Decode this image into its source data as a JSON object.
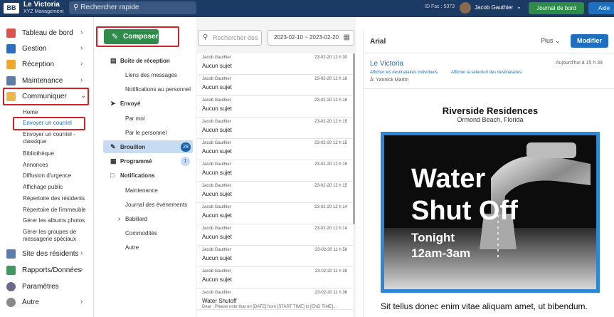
{
  "topbar": {
    "org_name": "Le Victoria",
    "org_sub": "XYZ Management",
    "search_label": "Rechercher rapide",
    "id_fac": "ID Fac : 5373",
    "user_name": "Jacob Gauthier",
    "dashboard_btn": "Journal de bord",
    "help_btn": "Aide",
    "colors": {
      "bar": "#1b3a64",
      "green": "#2e8b4a",
      "blue": "#1f6fc0"
    }
  },
  "sidebar": {
    "nav": [
      {
        "label": "Tableau de bord",
        "icon": "dashboard-icon"
      },
      {
        "label": "Gestion",
        "icon": "building-icon"
      },
      {
        "label": "Réception",
        "icon": "bell-icon"
      },
      {
        "label": "Maintenance",
        "icon": "wrench-icon"
      },
      {
        "label": "Communiquer",
        "icon": "envelope-icon"
      },
      {
        "label": "Site des résidents",
        "icon": "monitor-icon"
      },
      {
        "label": "Rapports/Données",
        "icon": "chart-icon"
      },
      {
        "label": "Paramètres",
        "icon": "gear-icon"
      },
      {
        "label": "Autre",
        "icon": "more-icon"
      }
    ],
    "sub": [
      "Home",
      "Envoyer un courriel",
      "Envoyer un courriel - classique",
      "Bibliothèque",
      "Annonces",
      "Diffusion d'urgence",
      "Affichage public",
      "Répertoire des résidents",
      "Répertoire de l'immeuble",
      "Gérer les albums photos",
      "Gérer les groupes de messagerie spéciaux"
    ]
  },
  "folders": {
    "compose": "Composer",
    "items": [
      {
        "label": "Boîte de réception"
      },
      {
        "label": "Liens des messages"
      },
      {
        "label": "Notifications au personnel"
      },
      {
        "label": "Envoyé"
      },
      {
        "label": "Par moi"
      },
      {
        "label": "Par le personnel"
      },
      {
        "label": "Brouillon",
        "badge": "28"
      },
      {
        "label": "Programmé",
        "badge": "1"
      },
      {
        "label": "Notifications"
      },
      {
        "label": "Maintenance"
      },
      {
        "label": "Journal des événements"
      },
      {
        "label": "Babillard"
      },
      {
        "label": "Commodités"
      },
      {
        "label": "Autre"
      }
    ]
  },
  "messages": {
    "search_placeholder": "Rechercher des",
    "date_range": "2023-02-10 ~ 2023-02-20",
    "list": [
      {
        "from": "Jacob Gauthier",
        "date": "23-02-20 12 h 30",
        "subject": "Aucun sujet"
      },
      {
        "from": "Jacob Gauthier",
        "date": "23-02-20 12 h 18",
        "subject": "Aucun sujet"
      },
      {
        "from": "Jacob Gauthier",
        "date": "23-02-20 12 h 18",
        "subject": "Aucun sujet"
      },
      {
        "from": "Jacob Gauthier",
        "date": "23-02-20 12 h 15",
        "subject": "Aucun sujet"
      },
      {
        "from": "Jacob Gauthier",
        "date": "23-02-20 12 h 15",
        "subject": "Aucun sujet"
      },
      {
        "from": "Jacob Gauthier",
        "date": "23-02-20 12 h 15",
        "subject": "Aucun sujet"
      },
      {
        "from": "Jacob Gauthier",
        "date": "23-02-20 12 h 15",
        "subject": "Aucun sujet"
      },
      {
        "from": "Jacob Gauthier",
        "date": "23-02-20 12 h 14",
        "subject": "Aucun sujet"
      },
      {
        "from": "Jacob Gauthier",
        "date": "23-02-20 12 h 14",
        "subject": "Aucun sujet"
      },
      {
        "from": "Jacob Gauthier",
        "date": "23-02-20 11 h 58",
        "subject": "Aucun sujet"
      },
      {
        "from": "Jacob Gauthier",
        "date": "23-02-20 11 h 39",
        "subject": "Aucun sujet"
      },
      {
        "from": "Jacob Gauthier",
        "date": "23-02-20 11 h 36",
        "subject": "Water Shutoff",
        "preview": "Dear , Please note that on [DATE] from [START TIME] to [END TIME]..."
      }
    ]
  },
  "preview": {
    "font": "Arial",
    "more": "Plus",
    "modify": "Modifier",
    "from": "Le Victoria",
    "when": "Aujourd'hui à 15 h 39",
    "link1": "Afficher les destinataires individuels",
    "link2": "Afficher la sélection des destinataires",
    "to": "À: Yannick Martin",
    "title": "Riverside Residences",
    "subtitle": "Ormond Beach, Florida",
    "poster": {
      "line1": "Water",
      "line2": "Shut Off",
      "line3": "Tonight",
      "line4": "12am-3am"
    },
    "body": "Sit tellus donec enim vitae aliquam amet, ut bibendum."
  }
}
